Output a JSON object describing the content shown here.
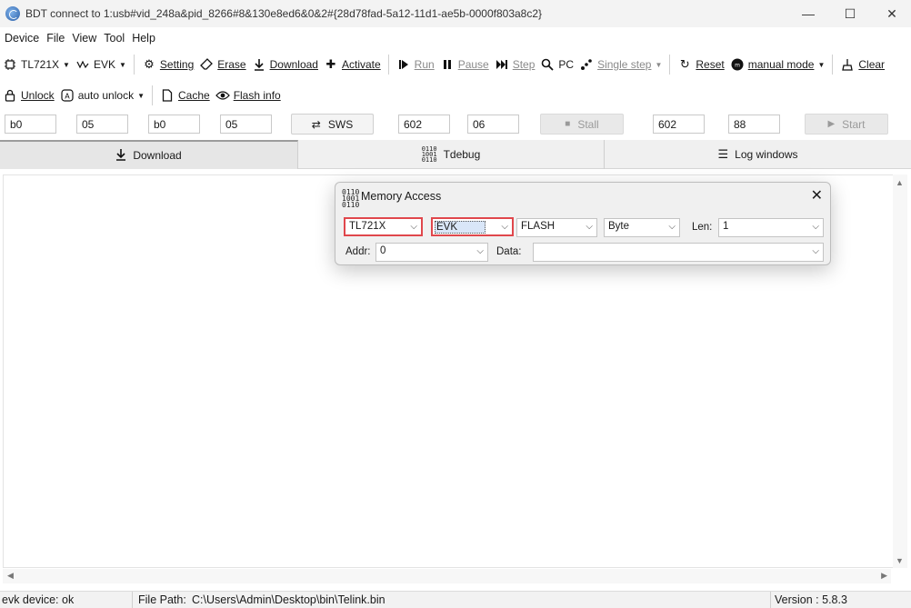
{
  "window": {
    "title": "BDT connect to 1:usb#vid_248a&pid_8266#8&130e8ed6&0&2#{28d78fad-5a12-11d1-ae5b-0000f803a8c2}",
    "minimize_glyph": "—",
    "maximize_glyph": "☐",
    "close_glyph": "✕"
  },
  "menu": [
    "Device",
    "File",
    "View",
    "Tool",
    "Help"
  ],
  "toolbar1": {
    "chip": "TL721X",
    "board": "EVK",
    "setting": "Setting",
    "erase": "Erase",
    "download": "Download",
    "activate": "Activate",
    "run": "Run",
    "pause": "Pause",
    "step": "Step",
    "pc": "PC",
    "single_step": "Single step",
    "reset": "Reset",
    "mode": "manual mode",
    "clear": "Clear"
  },
  "toolbar2": {
    "unlock": "Unlock",
    "auto_unlock": "auto unlock",
    "cache": "Cache",
    "flash_info": "Flash info"
  },
  "fields": {
    "f1": "b0",
    "f2": "05",
    "f3": "b0",
    "f4": "05",
    "sws": "SWS",
    "f5": "602",
    "f6": "06",
    "stall": "Stall",
    "f7": "602",
    "f8": "88",
    "start": "Start"
  },
  "tabs": {
    "download": "Download",
    "tdebug": "Tdebug",
    "log": "Log windows"
  },
  "dialog": {
    "title": "Memory Access",
    "chip": "TL721X",
    "board": "EVK",
    "memory": "FLASH",
    "unit": "Byte",
    "len_label": "Len:",
    "len_value": "1",
    "addr_label": "Addr:",
    "addr_value": "0",
    "data_label": "Data:",
    "data_value": "",
    "highlight_color": "#e0474c"
  },
  "status": {
    "device": "evk device: ok",
    "file_path_label": "File Path:",
    "file_path": "C:\\Users\\Admin\\Desktop\\bin\\Telink.bin",
    "version": "Version : 5.8.3"
  }
}
